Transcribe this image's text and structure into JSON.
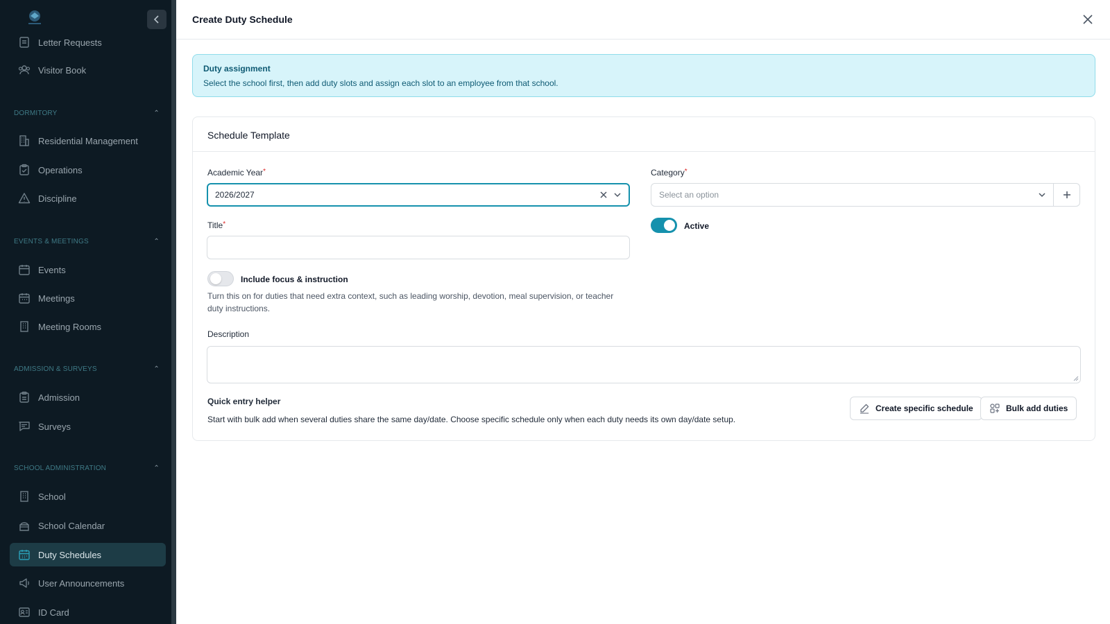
{
  "sidebar": {
    "items_top": [
      {
        "label": "Letter Requests",
        "icon": "document-icon"
      },
      {
        "label": "Visitor Book",
        "icon": "users-icon"
      }
    ],
    "sections": [
      {
        "title": "DORMITORY",
        "items": [
          {
            "label": "Residential Management",
            "icon": "building-icon"
          },
          {
            "label": "Operations",
            "icon": "clipboard-check-icon"
          },
          {
            "label": "Discipline",
            "icon": "warning-icon"
          }
        ]
      },
      {
        "title": "EVENTS & MEETINGS",
        "items": [
          {
            "label": "Events",
            "icon": "calendar-icon"
          },
          {
            "label": "Meetings",
            "icon": "calendar-icon"
          },
          {
            "label": "Meeting Rooms",
            "icon": "building-icon"
          }
        ]
      },
      {
        "title": "ADMISSION & SURVEYS",
        "items": [
          {
            "label": "Admission",
            "icon": "clipboard-icon"
          },
          {
            "label": "Surveys",
            "icon": "chat-icon"
          }
        ]
      },
      {
        "title": "SCHOOL ADMINISTRATION",
        "items": [
          {
            "label": "School",
            "icon": "building-icon"
          },
          {
            "label": "School Calendar",
            "icon": "calendar-icon"
          },
          {
            "label": "Duty Schedules",
            "icon": "calendar-icon",
            "active": true
          },
          {
            "label": "User Announcements",
            "icon": "megaphone-icon"
          },
          {
            "label": "ID Card",
            "icon": "id-card-icon"
          }
        ]
      }
    ]
  },
  "panel": {
    "title": "Create Duty Schedule",
    "info": {
      "title": "Duty assignment",
      "text": "Select the school first, then add duty slots and assign each slot to an employee from that school."
    },
    "card_title": "Schedule Template",
    "form": {
      "academic_year_label": "Academic Year",
      "academic_year_value": "2026/2027",
      "category_label": "Category",
      "category_placeholder": "Select an option",
      "title_label": "Title",
      "title_value": "",
      "active_label": "Active",
      "active": true,
      "focus_label": "Include focus & instruction",
      "focus_enabled": false,
      "focus_helper": "Turn this on for duties that need extra context, such as leading worship, devotion, meal supervision, or teacher duty instructions.",
      "description_label": "Description",
      "description_value": "",
      "quick_entry_title": "Quick entry helper",
      "quick_entry_text": "Start with bulk add when several duties share the same day/date. Choose specific schedule only when each duty needs its own day/date setup.",
      "create_specific_label": "Create specific schedule",
      "bulk_add_label": "Bulk add duties"
    }
  },
  "colors": {
    "accent": "#1591ad",
    "sidebar_bg": "#0d1a23",
    "info_bg": "#d7f4fa",
    "required": "#dc2626"
  }
}
